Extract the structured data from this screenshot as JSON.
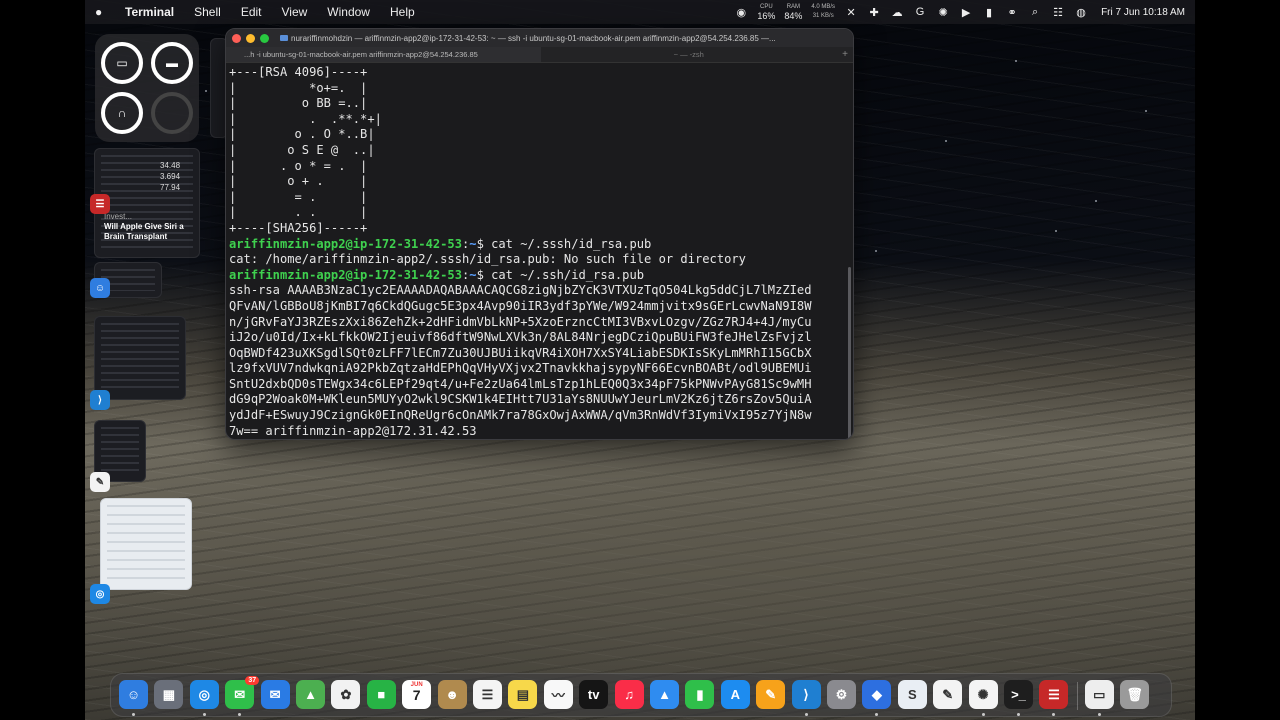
{
  "menubar": {
    "app_name": "Terminal",
    "menus": [
      "Shell",
      "Edit",
      "View",
      "Window",
      "Help"
    ],
    "cpu_label": "CPU",
    "cpu_value": "16%",
    "ram_label": "RAM",
    "ram_value": "84%",
    "net_up": "4.0 MB/s",
    "net_down": "31 KB/s",
    "datetime": "Fri 7 Jun  10:18 AM"
  },
  "stage": {
    "news_headline": "Will Apple Give Siri a Brain Transplant",
    "news_source": "Invest...",
    "stock_values": [
      "34.48",
      "3.694",
      "77.94"
    ]
  },
  "terminal": {
    "window_title": "nurariffinmohdzin — ariffinmzin-app2@ip-172-31-42-53: ~ — ssh -i ubuntu-sg-01-macbook-air.pem ariffinmzin-app2@54.254.236.85 —...",
    "tabs": [
      {
        "label": "...h -i ubuntu-sg-01-macbook-air.pem ariffinmzin-app2@54.254.236.85"
      },
      {
        "label": "~ — -zsh"
      }
    ],
    "lines": [
      {
        "text": "+---[RSA 4096]----+"
      },
      {
        "text": "|          *o+=.  |"
      },
      {
        "text": "|         o BB =..|"
      },
      {
        "text": "|          .  .**.*+|"
      },
      {
        "text": "|        o . O *..B|"
      },
      {
        "text": "|       o S E @  ..|"
      },
      {
        "text": "|      . o * = .  |"
      },
      {
        "text": "|       o + .     |"
      },
      {
        "text": "|        = .      |"
      },
      {
        "text": "|        . .      |"
      },
      {
        "text": "+----[SHA256]-----+"
      },
      {
        "user": "ariffinmzin-app2@ip-172-31-42-53",
        "path": "~",
        "text": "$ cat ~/.sssh/id_rsa.pub"
      },
      {
        "text": "cat: /home/ariffinmzin-app2/.sssh/id_rsa.pub: No such file or directory"
      },
      {
        "user": "ariffinmzin-app2@ip-172-31-42-53",
        "path": "~",
        "text": "$ cat ~/.ssh/id_rsa.pub"
      },
      {
        "text": "ssh-rsa AAAAB3NzaC1yc2EAAAADAQABAAACAQCG8zigNjbZYcK3VTXUzTqO504Lkg5ddCjL7lMzZIed"
      },
      {
        "text": "QFvAN/lGBBoU8jKmBI7q6CkdQGugc5E3px4Avp90iIR3ydf3pYWe/W924mmjvitx9sGErLcwvNaN9I8W"
      },
      {
        "text": "n/jGRvFaYJ3RZEszXxi86ZehZk+2dHFidmVbLkNP+5XzoErzncCtMI3VBxvLOzgv/ZGz7RJ4+4J/myCu"
      },
      {
        "text": "iJ2o/u0Id/Ix+kLfkkOW2Ijeuivf86dftW9NwLXVk3n/8AL84NrjegDCziQpuBUiFW3feJHelZsFvjzl"
      },
      {
        "text": "OqBWDf423uXKSgdlSQt0zLFF7lECm7Zu30UJBUiikqVR4iXOH7XxSY4LiabESDKIsSKyLmMRhI15GCbX"
      },
      {
        "text": "lz9fxVUV7ndwkqniA92PkbZqtzaHdEPhQqVHyVXjvx2TnavkkhajsypyNF66EcvnBOABt/odl9UBEMUi"
      },
      {
        "text": "SntU2dxbQD0sTEWgx34c6LEPf29qt4/u+Fe2zUa64lmLsTzp1hLEQ0Q3x34pF75kPNWvPAyG81Sc9wMH"
      },
      {
        "text": "dG9qP2Woak0M+WKleun5MUYyO2wkl9CSKW1k4EIHtt7U31aYs8NUUwYJeurLmV2Kz6jtZ6rsZov5QuiA"
      },
      {
        "text": "ydJdF+ESwuyJ9CzignGk0EInQReUgr6cOnAMk7ra78GxOwjAxWWA/qVm3RnWdVf3IymiVxI95z7YjN8w"
      },
      {
        "text": "7w== ariffinmzin-app2@172.31.42.53"
      }
    ]
  },
  "dock": {
    "apps": [
      {
        "name": "finder",
        "glyph": "☺",
        "color": "#2f7de0"
      },
      {
        "name": "launchpad",
        "glyph": "▦",
        "color": "#6a6f7a"
      },
      {
        "name": "safari",
        "glyph": "◎",
        "color": "#1e88e5"
      },
      {
        "name": "messages",
        "glyph": "✉",
        "color": "#2fbf4a",
        "badge": "37"
      },
      {
        "name": "mail",
        "glyph": "✉",
        "color": "#2a7be4"
      },
      {
        "name": "maps",
        "glyph": "▲",
        "color": "#4caf50"
      },
      {
        "name": "photos",
        "glyph": "✿",
        "color": "#f2f2f2"
      },
      {
        "name": "facetime",
        "glyph": "■",
        "color": "#27b345"
      },
      {
        "name": "calendar",
        "glyph": "7",
        "color": "#ffffff",
        "sub": "JUN"
      },
      {
        "name": "contacts",
        "glyph": "☻",
        "color": "#b08a4e"
      },
      {
        "name": "reminders",
        "glyph": "☰",
        "color": "#f4f4f4"
      },
      {
        "name": "notes",
        "glyph": "▤",
        "color": "#f7d84a"
      },
      {
        "name": "freeform",
        "glyph": "〰",
        "color": "#f8f8f8"
      },
      {
        "name": "tv",
        "glyph": "tv",
        "color": "#151515"
      },
      {
        "name": "music",
        "glyph": "♫",
        "color": "#fa2d48"
      },
      {
        "name": "keynote",
        "glyph": "▲",
        "color": "#2f8cf0"
      },
      {
        "name": "numbers",
        "glyph": "▮",
        "color": "#2fbf4a"
      },
      {
        "name": "app-store",
        "glyph": "A",
        "color": "#1d8cf0"
      },
      {
        "name": "pages",
        "glyph": "✎",
        "color": "#f7a21a"
      },
      {
        "name": "vscode",
        "glyph": "⟩",
        "color": "#1f7fd1"
      },
      {
        "name": "system-settings",
        "glyph": "⚙",
        "color": "#8a8a8f"
      },
      {
        "name": "roblox",
        "glyph": "◆",
        "color": "#2d6fe0"
      },
      {
        "name": "sublime",
        "glyph": "S",
        "color": "#e9eef4"
      },
      {
        "name": "textedit",
        "glyph": "✎",
        "color": "#f3f3f3"
      },
      {
        "name": "chatgpt",
        "glyph": "✺",
        "color": "#f4f4f4"
      },
      {
        "name": "terminal",
        "glyph": ">_",
        "color": "#1e1e1e"
      },
      {
        "name": "database-app",
        "glyph": "☰",
        "color": "#c62828"
      },
      {
        "name": "preview",
        "glyph": "▭",
        "color": "#eeeeee"
      },
      {
        "name": "trash",
        "glyph": "🗑",
        "color": "#9a9a9a"
      }
    ]
  }
}
